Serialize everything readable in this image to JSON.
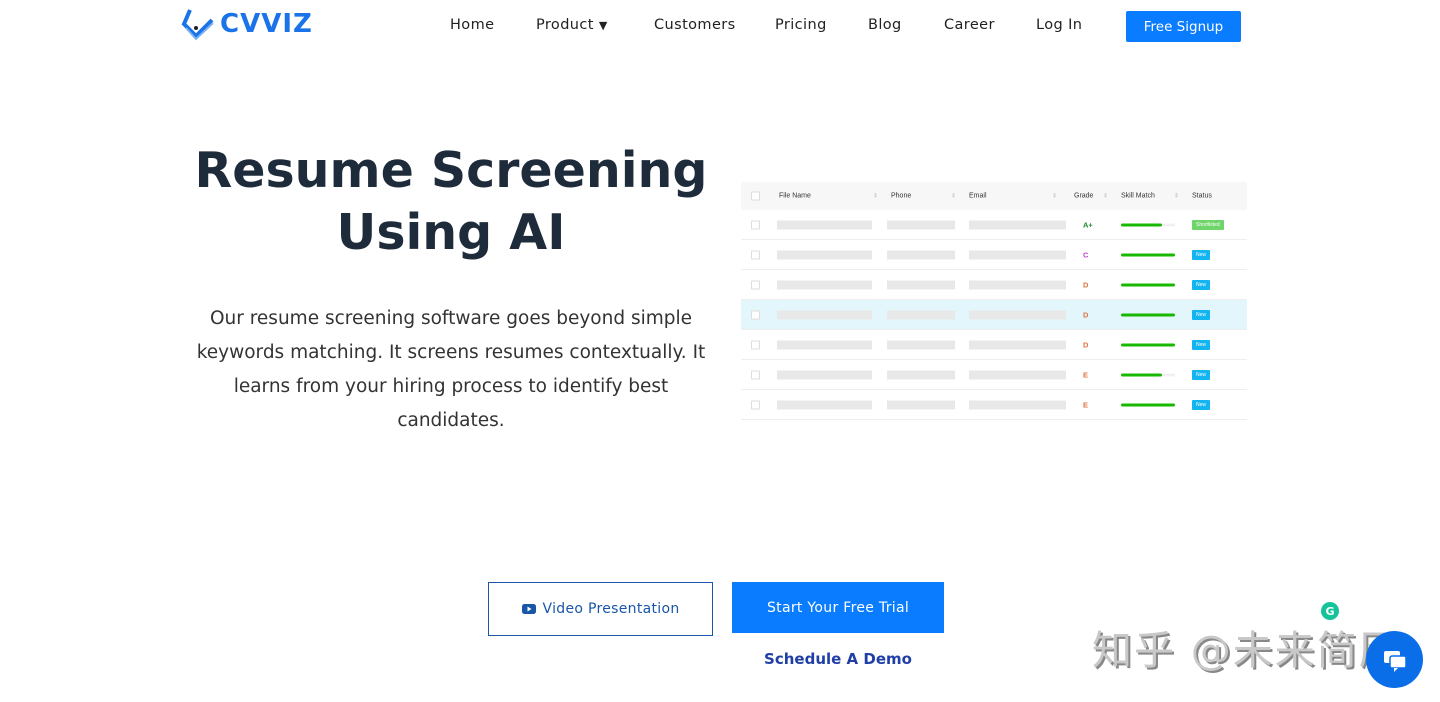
{
  "brand": {
    "name": "CVVIZ",
    "color": "#1a73e8"
  },
  "nav": {
    "items": [
      "Home",
      "Product",
      "Customers",
      "Pricing",
      "Blog",
      "Career",
      "Log In"
    ],
    "signup": "Free Signup"
  },
  "hero": {
    "title_line1": "Resume Screening",
    "title_line2": "Using AI",
    "description": "Our resume screening software goes beyond simple keywords matching. It screens resumes contextually. It learns from your hiring process to identify best candidates."
  },
  "table": {
    "columns": [
      "File Name",
      "Phone",
      "Email",
      "Grade",
      "Skill Match",
      "Status"
    ],
    "rows": [
      {
        "grade": "A+",
        "grade_color": "#1f8a2a",
        "skill": 0.75,
        "status": "Shortlisted",
        "status_color": "#6fd56b"
      },
      {
        "grade": "C",
        "grade_color": "#c03fd0",
        "skill": 1.0,
        "status": "New",
        "status_color": "#13b5f0"
      },
      {
        "grade": "D",
        "grade_color": "#e0733f",
        "skill": 1.0,
        "status": "New",
        "status_color": "#13b5f0"
      },
      {
        "grade": "D",
        "grade_color": "#e0733f",
        "skill": 1.0,
        "status": "New",
        "status_color": "#13b5f0"
      },
      {
        "grade": "D",
        "grade_color": "#e0733f",
        "skill": 1.0,
        "status": "New",
        "status_color": "#13b5f0"
      },
      {
        "grade": "E",
        "grade_color": "#e0733f",
        "skill": 0.75,
        "status": "New",
        "status_color": "#13b5f0"
      },
      {
        "grade": "E",
        "grade_color": "#e0733f",
        "skill": 1.0,
        "status": "New",
        "status_color": "#13b5f0"
      }
    ]
  },
  "cta": {
    "video": "Video Presentation",
    "trial": "Start Your Free Trial",
    "demo": "Schedule A Demo"
  },
  "watermark": "知乎 @未来简历",
  "accent": "#0a7cff"
}
